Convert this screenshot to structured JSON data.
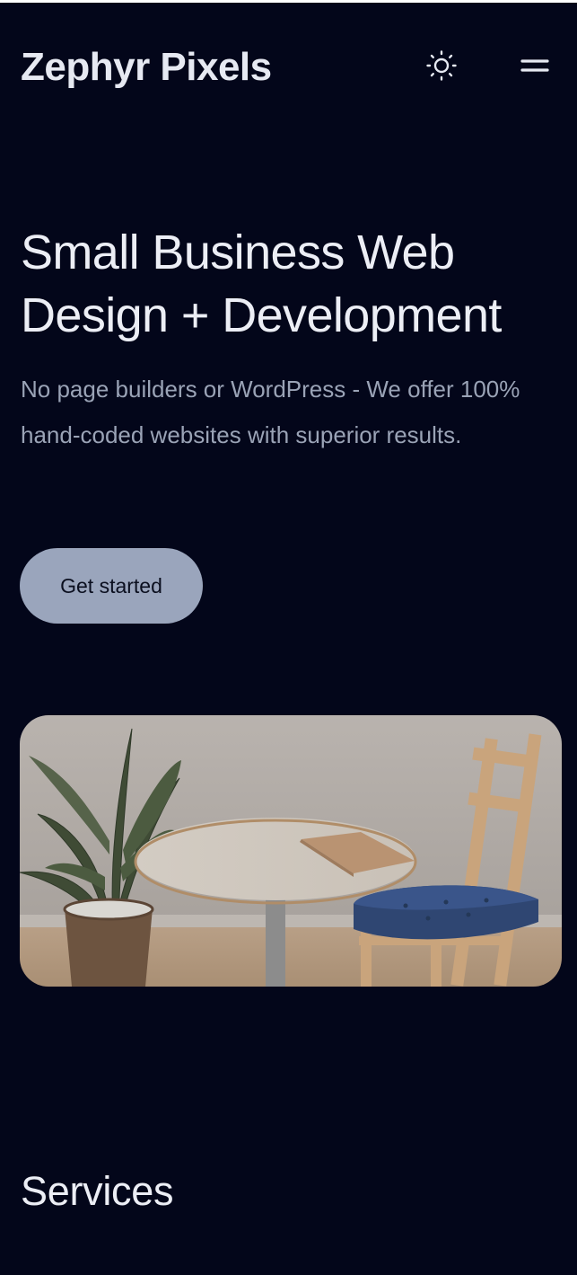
{
  "header": {
    "brand": "Zephyr Pixels",
    "theme_toggle_icon": "sun-icon",
    "menu_icon": "menu-icon"
  },
  "hero": {
    "title_line1": "Small Business Web",
    "title_line2": "Design + Development",
    "description": "No page builders or WordPress - We offer 100% hand-coded websites with superior results.",
    "cta_label": "Get started",
    "image_subject": "office-table-chair-plant"
  },
  "services": {
    "heading": "Services"
  },
  "colors": {
    "background": "#03061a",
    "text": "#e6e9f2",
    "muted_text": "#9aa3b6",
    "button_bg": "#9aa5bc"
  }
}
